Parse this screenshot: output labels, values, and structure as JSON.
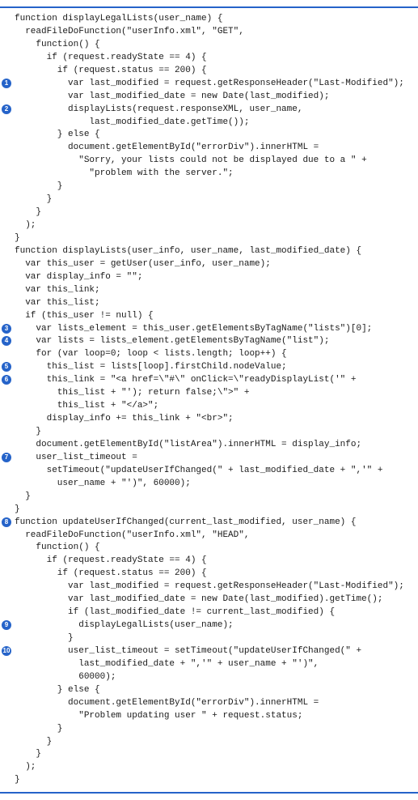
{
  "lines": [
    {
      "marker": "",
      "indent": 0,
      "text": "function displayLegalLists(user_name) {"
    },
    {
      "marker": "",
      "indent": 0,
      "text": ""
    },
    {
      "marker": "",
      "indent": 1,
      "text": "readFileDoFunction(\"userInfo.xml\", \"GET\","
    },
    {
      "marker": "",
      "indent": 2,
      "text": "function() {"
    },
    {
      "marker": "",
      "indent": 3,
      "text": "if (request.readyState == 4) {"
    },
    {
      "marker": "",
      "indent": 4,
      "text": "if (request.status == 200) {"
    },
    {
      "marker": "1",
      "indent": 5,
      "text": "var last_modified = request.getResponseHeader(\"Last-Modified\");"
    },
    {
      "marker": "",
      "indent": 5,
      "text": "var last_modified_date = new Date(last_modified);"
    },
    {
      "marker": "2",
      "indent": 5,
      "text": "displayLists(request.responseXML, user_name,"
    },
    {
      "marker": "",
      "indent": 7,
      "text": "last_modified_date.getTime());"
    },
    {
      "marker": "",
      "indent": 4,
      "text": "} else {"
    },
    {
      "marker": "",
      "indent": 5,
      "text": "document.getElementById(\"errorDiv\").innerHTML ="
    },
    {
      "marker": "",
      "indent": 6,
      "text": "\"Sorry, your lists could not be displayed due to a \" +"
    },
    {
      "marker": "",
      "indent": 7,
      "text": "\"problem with the server.\";"
    },
    {
      "marker": "",
      "indent": 4,
      "text": "}"
    },
    {
      "marker": "",
      "indent": 3,
      "text": "}"
    },
    {
      "marker": "",
      "indent": 2,
      "text": "}"
    },
    {
      "marker": "",
      "indent": 1,
      "text": ");"
    },
    {
      "marker": "",
      "indent": 0,
      "text": "}"
    },
    {
      "marker": "",
      "indent": 0,
      "text": ""
    },
    {
      "marker": "",
      "indent": 0,
      "text": ""
    },
    {
      "marker": "",
      "indent": 0,
      "text": "function displayLists(user_info, user_name, last_modified_date) {"
    },
    {
      "marker": "",
      "indent": 1,
      "text": "var this_user = getUser(user_info, user_name);"
    },
    {
      "marker": "",
      "indent": 1,
      "text": "var display_info = \"\";"
    },
    {
      "marker": "",
      "indent": 1,
      "text": "var this_link;"
    },
    {
      "marker": "",
      "indent": 1,
      "text": "var this_list;"
    },
    {
      "marker": "",
      "indent": 1,
      "text": "if (this_user != null) {"
    },
    {
      "marker": "3",
      "indent": 2,
      "text": "var lists_element = this_user.getElementsByTagName(\"lists\")[0];"
    },
    {
      "marker": "4",
      "indent": 2,
      "text": "var lists = lists_element.getElementsByTagName(\"list\");"
    },
    {
      "marker": "",
      "indent": 2,
      "text": "for (var loop=0; loop < lists.length; loop++) {"
    },
    {
      "marker": "5",
      "indent": 3,
      "text": "this_list = lists[loop].firstChild.nodeValue;"
    },
    {
      "marker": "6",
      "indent": 3,
      "text": "this_link = \"<a href=\\\"#\\\" onClick=\\\"readyDisplayList('\" +"
    },
    {
      "marker": "",
      "indent": 4,
      "text": "this_list + \"'); return false;\\\">\" +"
    },
    {
      "marker": "",
      "indent": 0,
      "text": ""
    },
    {
      "marker": "",
      "indent": 4,
      "text": "this_list + \"</a>\";"
    },
    {
      "marker": "",
      "indent": 3,
      "text": "display_info += this_link + \"<br>\";"
    },
    {
      "marker": "",
      "indent": 2,
      "text": "}"
    },
    {
      "marker": "",
      "indent": 0,
      "text": ""
    },
    {
      "marker": "",
      "indent": 2,
      "text": "document.getElementById(\"listArea\").innerHTML = display_info;"
    },
    {
      "marker": "7",
      "indent": 2,
      "text": "user_list_timeout ="
    },
    {
      "marker": "",
      "indent": 3,
      "text": "setTimeout(\"updateUserIfChanged(\" + last_modified_date + \",'\" +"
    },
    {
      "marker": "",
      "indent": 4,
      "text": "user_name + \"')\", 60000);"
    },
    {
      "marker": "",
      "indent": 1,
      "text": "}"
    },
    {
      "marker": "",
      "indent": 0,
      "text": "}"
    },
    {
      "marker": "",
      "indent": 0,
      "text": ""
    },
    {
      "marker": "8",
      "indent": 0,
      "text": "function updateUserIfChanged(current_last_modified, user_name) {"
    },
    {
      "marker": "",
      "indent": 0,
      "text": ""
    },
    {
      "marker": "",
      "indent": 1,
      "text": "readFileDoFunction(\"userInfo.xml\", \"HEAD\","
    },
    {
      "marker": "",
      "indent": 2,
      "text": "function() {"
    },
    {
      "marker": "",
      "indent": 3,
      "text": "if (request.readyState == 4) {"
    },
    {
      "marker": "",
      "indent": 4,
      "text": "if (request.status == 200) {"
    },
    {
      "marker": "",
      "indent": 5,
      "text": "var last_modified = request.getResponseHeader(\"Last-Modified\");"
    },
    {
      "marker": "",
      "indent": 5,
      "text": "var last_modified_date = new Date(last_modified).getTime();"
    },
    {
      "marker": "",
      "indent": 5,
      "text": "if (last_modified_date != current_last_modified) {"
    },
    {
      "marker": "9",
      "indent": 6,
      "text": "displayLegalLists(user_name);"
    },
    {
      "marker": "",
      "indent": 5,
      "text": "}"
    },
    {
      "marker": "10",
      "indent": 5,
      "text": "user_list_timeout = setTimeout(\"updateUserIfChanged(\" +"
    },
    {
      "marker": "",
      "indent": 6,
      "text": "last_modified_date + \",'\" + user_name + \"')\","
    },
    {
      "marker": "",
      "indent": 6,
      "text": "60000);"
    },
    {
      "marker": "",
      "indent": 4,
      "text": "} else {"
    },
    {
      "marker": "",
      "indent": 5,
      "text": "document.getElementById(\"errorDiv\").innerHTML ="
    },
    {
      "marker": "",
      "indent": 6,
      "text": "\"Problem updating user \" + request.status;"
    },
    {
      "marker": "",
      "indent": 4,
      "text": "}"
    },
    {
      "marker": "",
      "indent": 3,
      "text": "}"
    },
    {
      "marker": "",
      "indent": 2,
      "text": "}"
    },
    {
      "marker": "",
      "indent": 1,
      "text": ");"
    },
    {
      "marker": "",
      "indent": 0,
      "text": "}"
    }
  ],
  "indent_unit": "  "
}
